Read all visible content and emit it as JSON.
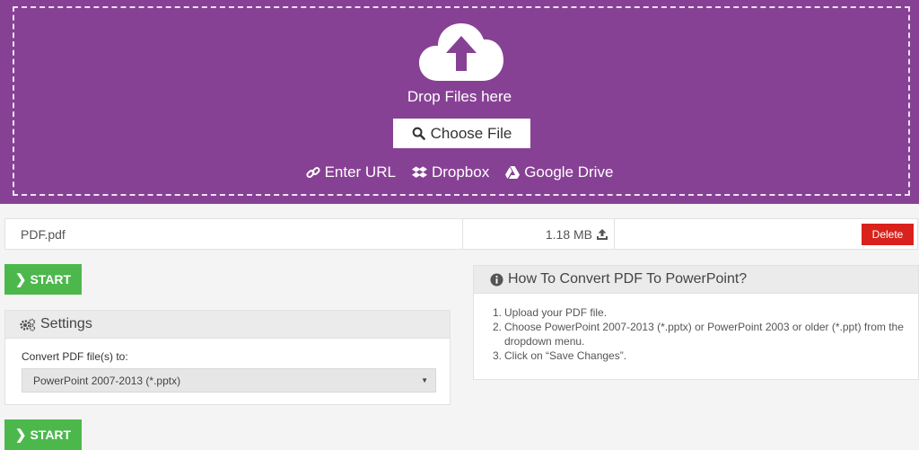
{
  "upload": {
    "drop_text": "Drop Files here",
    "choose_label": "Choose File",
    "sources": [
      {
        "icon": "link-icon",
        "label": "Enter URL"
      },
      {
        "icon": "dropbox-icon",
        "label": "Dropbox"
      },
      {
        "icon": "google-drive-icon",
        "label": "Google Drive"
      }
    ]
  },
  "file": {
    "name": "PDF.pdf",
    "size": "1.18 MB",
    "delete_label": "Delete"
  },
  "start_label": "START",
  "settings": {
    "title": "Settings",
    "convert_label": "Convert PDF file(s) to:",
    "selected_format": "PowerPoint 2007-2013 (*.pptx)"
  },
  "howto": {
    "title": "How To Convert PDF To PowerPoint?",
    "steps": [
      "Upload your PDF file.",
      "Choose PowerPoint 2007-2013 (*.pptx) or PowerPoint 2003 or older (*.ppt) from the dropdown menu.",
      "Click on “Save Changes”."
    ]
  },
  "colors": {
    "brand_purple": "#874194",
    "start_green": "#4cb84c",
    "delete_red": "#d9221c"
  }
}
